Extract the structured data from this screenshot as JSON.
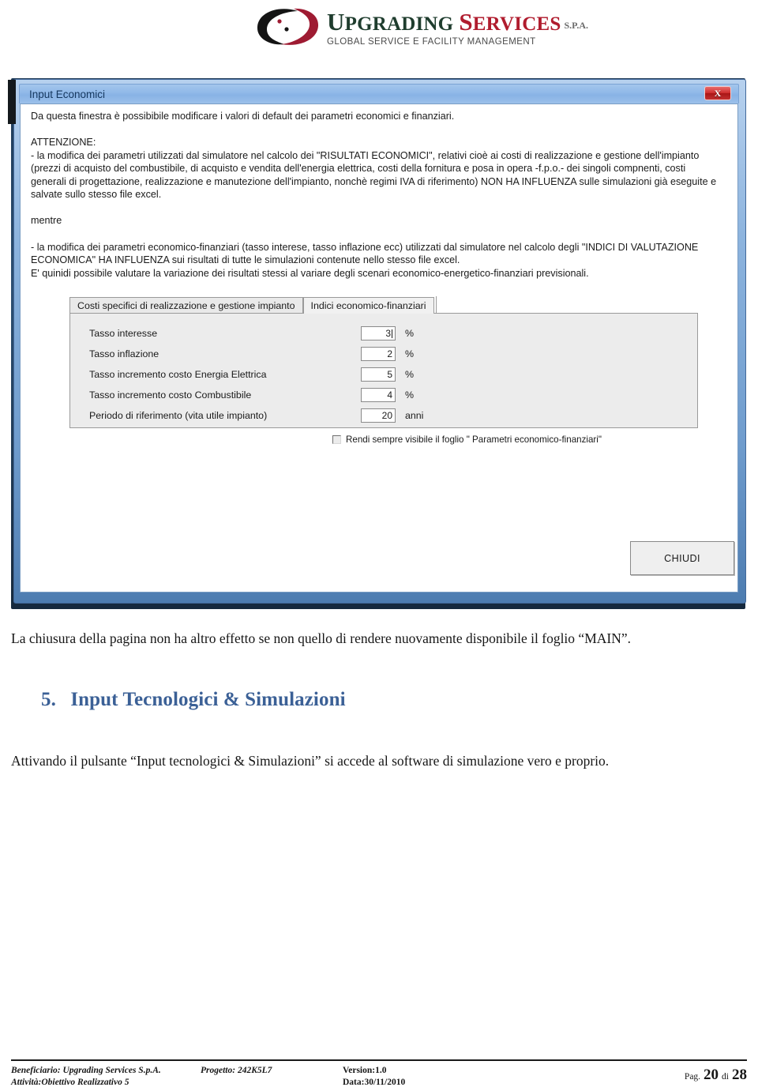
{
  "logo": {
    "word1_cap": "U",
    "word1_rest": "PGRADING",
    "word2_cap": "S",
    "word2_rest": "ERVICES",
    "suffix": "S.P.A.",
    "tagline": "GLOBAL SERVICE E FACILITY MANAGEMENT",
    "brand_green": "#1f3d2e",
    "brand_red": "#b01c2e"
  },
  "dialog": {
    "title": "Input Economici",
    "close_label": "X",
    "intro": "Da questa finestra è possibibile modificare i valori di default dei parametri economici e finanziari.",
    "warning_heading": "ATTENZIONE:",
    "warning_lines": [
      "- la modifica dei parametri utilizzati dal simulatore nel calcolo dei \"RISULTATI ECONOMICI\", relativi cioè ai costi di realizzazione e gestione dell'impianto",
      "(prezzi di acquisto del combustibile,  di acquisto e vendita dell'energia elettrica, costi della fornitura e posa in opera -f.p.o.- dei singoli compnenti, costi",
      "generali di progettazione, realizzazione e manutezione dell'impianto, nonchè regimi IVA di riferimento) NON HA INFLUENZA sulle simulazioni già eseguite e",
      "salvate sullo stesso file excel."
    ],
    "mentre": "mentre",
    "second_lines": [
      "- la modifica dei parametri economico-finanziari (tasso interese, tasso inflazione ecc) utilizzati dal simulatore nel calcolo degli \"INDICI DI VALUTAZIONE",
      "ECONOMICA\" HA INFLUENZA sui risultati di tutte le simulazioni contenute nello stesso file excel.",
      "E' quinidi possibile valutare la variazione dei risultati stessi al variare degli scenari economico-energetico-finanziari previsionali."
    ],
    "tabs": [
      {
        "label": "Costi specifici di realizzazione e gestione impianto",
        "active": false
      },
      {
        "label": "Indici economico-finanziari",
        "active": true
      }
    ],
    "fields": [
      {
        "label": "Tasso interesse",
        "value": "3",
        "unit": "%",
        "focused": true
      },
      {
        "label": "Tasso inflazione",
        "value": "2",
        "unit": "%",
        "focused": false
      },
      {
        "label": "Tasso incremento costo Energia Elettrica",
        "value": "5",
        "unit": "%",
        "focused": false
      },
      {
        "label": "Tasso incremento costo Combustibile",
        "value": "4",
        "unit": "%",
        "focused": false
      },
      {
        "label": "Periodo di riferimento (vita utile impianto)",
        "value": "20",
        "unit": "anni",
        "focused": false
      }
    ],
    "checkbox": {
      "label": "Rendi sempre visibile il foglio \" Parametri economico-finanziari\"",
      "checked": false
    },
    "close_button_label": "CHIUDI",
    "titlebar_color": "#8fb8e8",
    "close_button_color": "#cf2f2f"
  },
  "document": {
    "paragraph1": "La chiusura della pagina non ha altro effetto se non quello di rendere nuovamente disponibile il foglio “MAIN”.",
    "heading_number": "5.",
    "heading_text": "Input Tecnologici & Simulazioni",
    "heading_color": "#3b6096",
    "paragraph2": "Attivando il pulsante “Input tecnologici & Simulazioni” si accede al software di simulazione vero e proprio."
  },
  "footer": {
    "beneficiario": "Beneficiario: Upgrading Services S.p.A.",
    "attivita": "Attività:Obiettivo Realizzativo 5",
    "progetto": "Progetto: 242K5L7",
    "version": "Version:1.0",
    "data": "Data:30/11/2010",
    "page_prefix": "Pag.",
    "page_current": "20",
    "page_sep": "di",
    "page_total": "28"
  }
}
